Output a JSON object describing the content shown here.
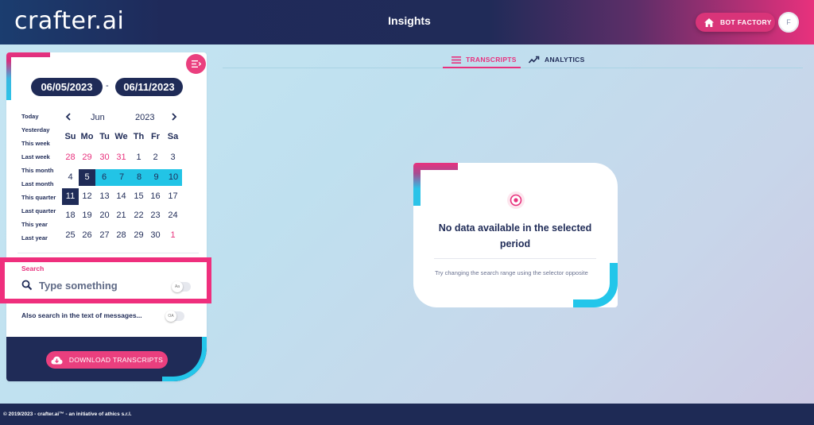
{
  "header": {
    "logo_text": "crafter.ai",
    "title": "Insights",
    "bot_factory_label": "BOT FACTORY",
    "avatar_initial": "F",
    "home_icon": "home-icon"
  },
  "date_range": {
    "start": "06/05/2023",
    "separator": "-",
    "end": "06/11/2023"
  },
  "quick_ranges": [
    "Today",
    "Yesterday",
    "This week",
    "Last week",
    "This month",
    "Last month",
    "This quarter",
    "Last quarter",
    "This year",
    "Last year"
  ],
  "calendar": {
    "month": "Jun",
    "year": "2023",
    "weekdays": [
      "Su",
      "Mo",
      "Tu",
      "We",
      "Th",
      "Fr",
      "Sa"
    ],
    "weeks": [
      [
        "28",
        "29",
        "30",
        "31",
        "1",
        "2",
        "3"
      ],
      [
        "4",
        "5",
        "6",
        "7",
        "8",
        "9",
        "10"
      ],
      [
        "11",
        "12",
        "13",
        "14",
        "15",
        "16",
        "17"
      ],
      [
        "18",
        "19",
        "20",
        "21",
        "22",
        "23",
        "24"
      ],
      [
        "25",
        "26",
        "27",
        "28",
        "29",
        "30",
        "1"
      ]
    ]
  },
  "search": {
    "label": "Search",
    "placeholder": "Type something",
    "toggle_label": "Aa",
    "also_search_label": "Also search in the text of messages...",
    "also_toggle_label": "OA"
  },
  "download_label": "DOWNLOAD TRANSCRIPTS",
  "tabs": [
    {
      "label": "TRANSCRIPTS",
      "active": true,
      "icon": "list-icon"
    },
    {
      "label": "ANALYTICS",
      "active": false,
      "icon": "trend-icon"
    }
  ],
  "empty_state": {
    "title": "No data available in the selected period",
    "description": "Try changing the search range using the selector opposite",
    "icon": "target-icon"
  },
  "footer": {
    "text": "© 2019/2023 - crafter.ai™ - an initiative of athics s.r.l."
  },
  "colors": {
    "navy": "#1f2b57",
    "pink": "#e8317d",
    "cyan": "#22c4e6"
  }
}
